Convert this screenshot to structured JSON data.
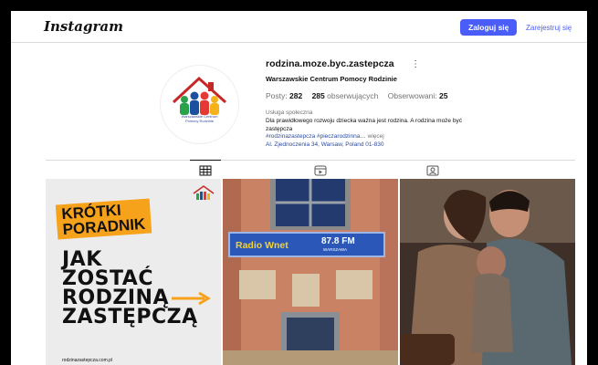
{
  "topbar": {
    "logo": "Instagram",
    "login_label": "Zaloguj się",
    "signup_label": "Zarejestruj się"
  },
  "profile": {
    "username": "rodzina.moze.byc.zastepcza",
    "more_icon": "⋮",
    "full_name": "Warszawskie Centrum Pomocy Rodzinie",
    "avatar_caption_1": "Warszawskie Centrum",
    "avatar_caption_2": "Pomocy Rodzinie",
    "stats": {
      "posts_label": "Posty:",
      "posts_value": "282",
      "followers_value": "285",
      "followers_label": "obserwujących",
      "following_label": "Obserwowani:",
      "following_value": "25"
    },
    "category": "Usługa społeczna",
    "bio": "Dla prawidłowego rozwoju dziecka ważna jest rodzina. A rodzina może być zastępcza",
    "tags": "#rodzinazastepcza #pieczarodzinna…",
    "more_label": "więcej",
    "address": "Al. Zjednoczenia 34, Warsaw, Poland 01-830"
  },
  "tabs": [
    {
      "name": "posts",
      "icon": "grid-icon",
      "active": true
    },
    {
      "name": "reels",
      "icon": "reels-icon",
      "active": false
    },
    {
      "name": "tagged",
      "icon": "tagged-icon",
      "active": false
    }
  ],
  "posts": [
    {
      "banner": [
        "KRÓTKI",
        "PORADNIK"
      ],
      "lines": [
        "JAK",
        "ZOSTAĆ",
        "RODZINĄ",
        "ZASTĘPCZĄ"
      ],
      "url": "rodzinazastepcza.com.pl"
    },
    {
      "sign_left": "Radio Wnet",
      "sign_freq": "87.8 FM",
      "sign_city": "WARSZAWA"
    },
    {}
  ],
  "colors": {
    "accent": "#4a5df9",
    "link": "#2b4ba3",
    "banner": "#f7a21b"
  }
}
